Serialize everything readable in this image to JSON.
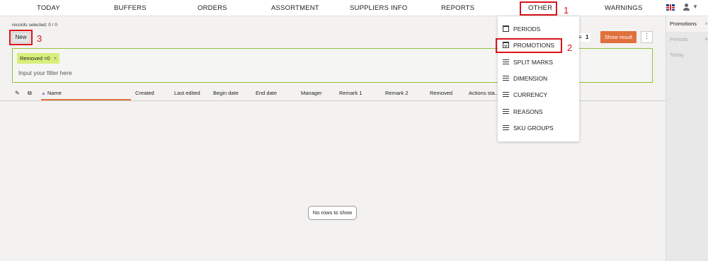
{
  "nav": {
    "items": [
      "TODAY",
      "BUFFERS",
      "ORDERS",
      "ASSORTMENT",
      "SUPPLIERS INFO",
      "REPORTS",
      "OTHER",
      "WARNINGS"
    ]
  },
  "toolbar": {
    "records_selected": "records selected: 0 / 0",
    "new_label": "New",
    "filter_count": "1",
    "show_result_label": "Show result",
    "more_label": "⋮"
  },
  "filter": {
    "chip_label": "Removed =0",
    "chip_remove": "×",
    "input_placeholder": "Input your filter here"
  },
  "grid": {
    "columns": [
      "Name",
      "Created",
      "Last edited",
      "Begin date",
      "End date",
      "Manager",
      "Remark 1",
      "Remark 2",
      "Removed",
      "Actions sta..."
    ],
    "empty_text": "No rows to show"
  },
  "dropdown": {
    "items": [
      {
        "label": "PERIODS",
        "icon": "calendar-icon"
      },
      {
        "label": "PROMOTIONS",
        "icon": "calendar-check-icon"
      },
      {
        "label": "SPLIT MARKS",
        "icon": "list-icon"
      },
      {
        "label": "DIMENSION",
        "icon": "list-icon"
      },
      {
        "label": "CURRENCY",
        "icon": "list-icon"
      },
      {
        "label": "REASONS",
        "icon": "list-icon"
      },
      {
        "label": "SKU GROUPS",
        "icon": "list-icon"
      }
    ]
  },
  "side_panel": {
    "items": [
      "Promotions",
      "Periods",
      "Today"
    ]
  },
  "annotations": {
    "n1": "1",
    "n2": "2",
    "n3": "3"
  },
  "colors": {
    "accent_orange": "#e0703c",
    "filter_green": "#97c13d",
    "chip_green": "#d7ef7b",
    "annotation_red": "#d9151b"
  }
}
